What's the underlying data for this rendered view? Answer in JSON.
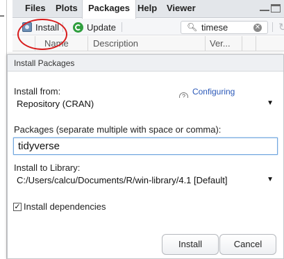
{
  "pane": {
    "tabs": [
      "Files",
      "Plots",
      "Packages",
      "Help",
      "Viewer"
    ],
    "active_tab": "Packages",
    "toolbar": {
      "install_label": "Install",
      "update_label": "Update",
      "search_value": "timese"
    },
    "columns": [
      "Name",
      "Description",
      "Ver..."
    ]
  },
  "dialog": {
    "title": "Install Packages",
    "install_from_label": "Install from:",
    "help_link": "Configuring Repositories",
    "help_icon_glyph": "?",
    "install_from_value": "Repository (CRAN)",
    "packages_label": "Packages (separate multiple with space or comma):",
    "packages_value": "tidyverse",
    "library_label": "Install to Library:",
    "library_value": "C:/Users/calcu/Documents/R/win-library/4.1 [Default]",
    "dependencies_label": "Install dependencies",
    "dependencies_checked": true,
    "install_button": "Install",
    "cancel_button": "Cancel"
  },
  "annotation": {
    "color": "#d81b1b",
    "shape": "ellipse",
    "target": "install-button"
  }
}
